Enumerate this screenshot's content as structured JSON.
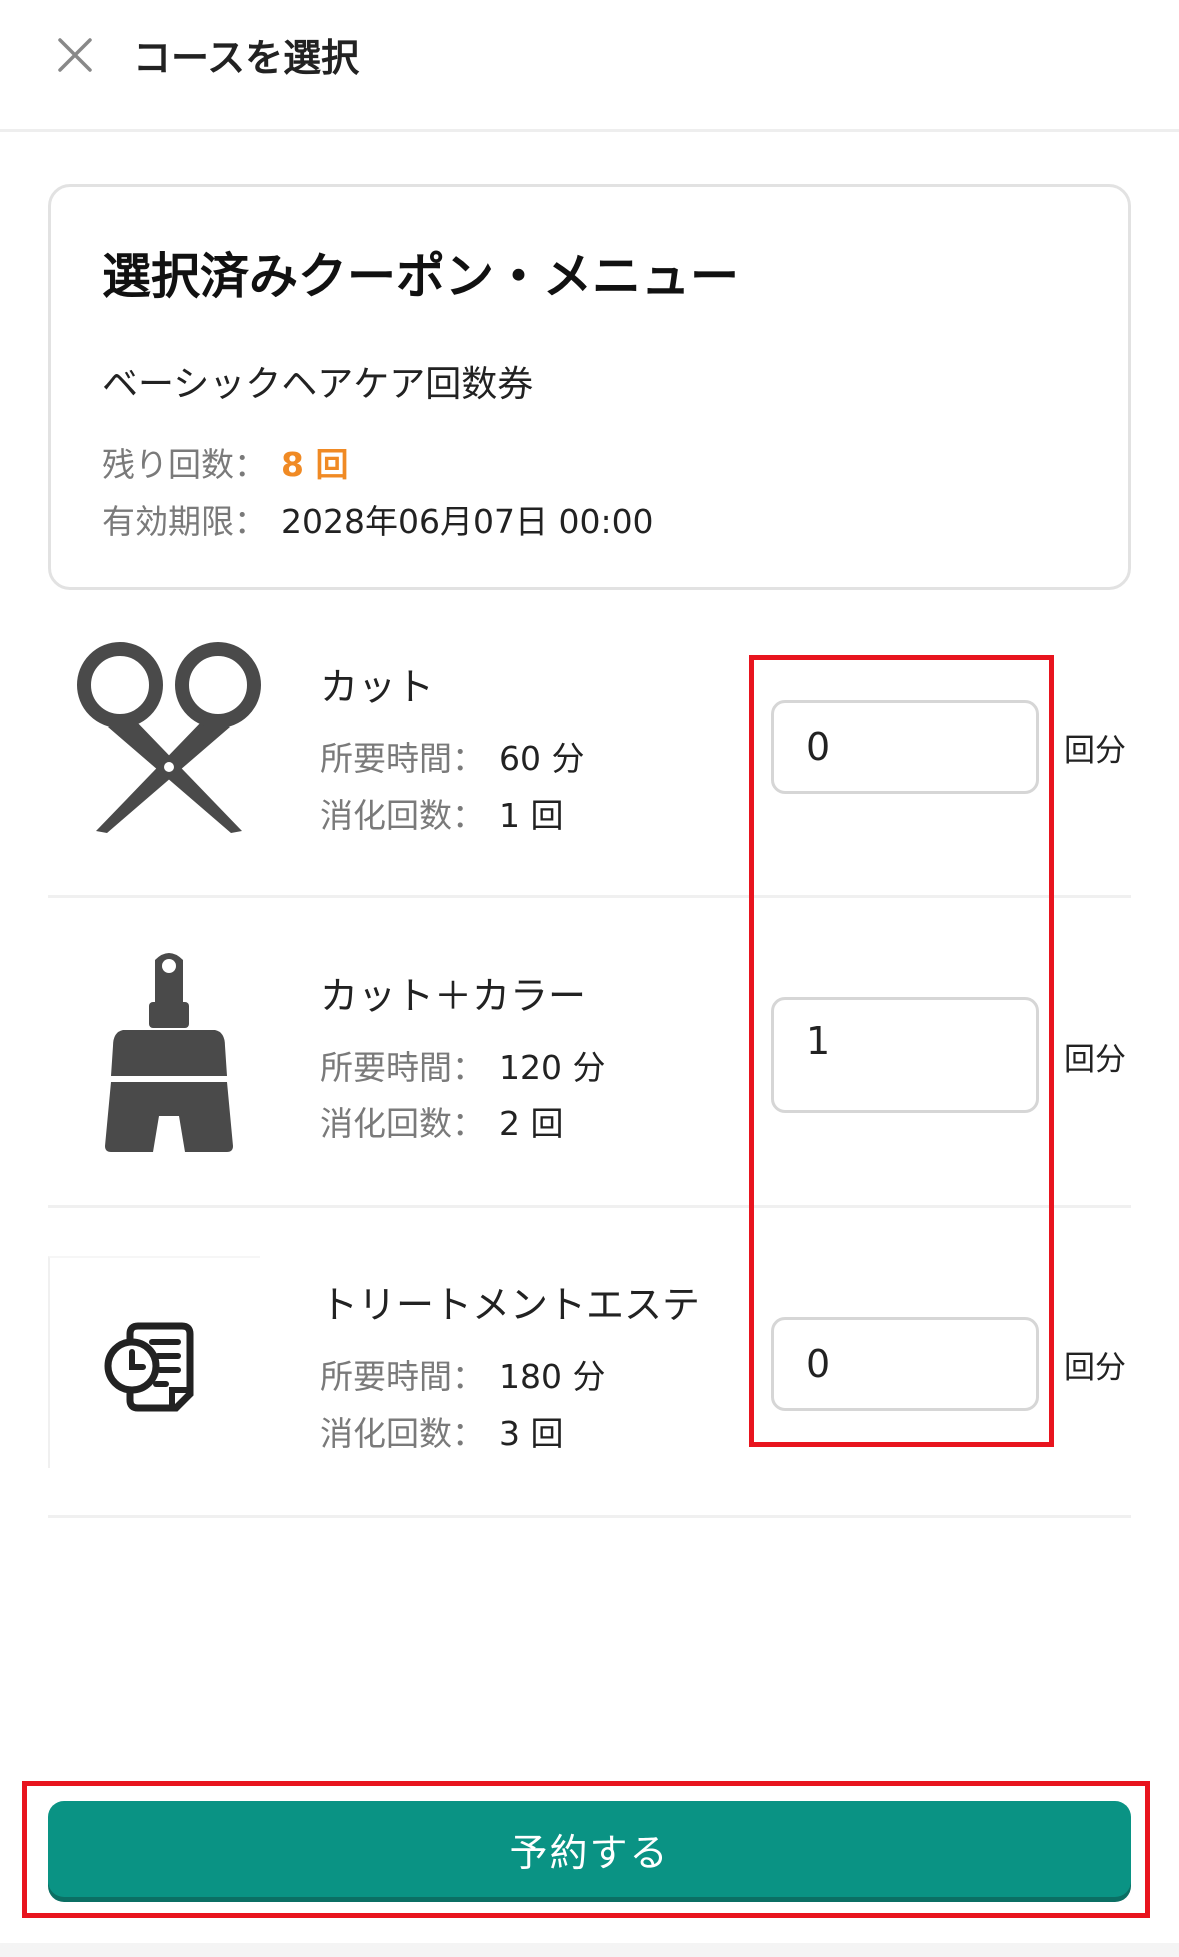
{
  "header": {
    "title": "コースを選択",
    "close_icon": "close-icon"
  },
  "selected": {
    "heading": "選択済みクーポン・メニュー",
    "name": "ベーシックヘアケア回数券",
    "remaining_label": "残り回数：",
    "remaining_value": "8 回",
    "expiry_label": "有効期限：",
    "expiry_value": "2028年06月07日 00:00"
  },
  "menu": {
    "items": [
      {
        "icon": "scissors-icon",
        "name": "カット",
        "duration_label": "所要時間：",
        "duration": "60 分",
        "consume_label": "消化回数：",
        "consume": "1 回",
        "quantity": "0",
        "unit": "回分"
      },
      {
        "icon": "brush-icon",
        "name": "カット＋カラー",
        "duration_label": "所要時間：",
        "duration": "120 分",
        "consume_label": "消化回数：",
        "consume": "2 回",
        "quantity": "1",
        "unit": "回分"
      },
      {
        "icon": "treatment-icon",
        "name": "トリートメントエステ",
        "duration_label": "所要時間：",
        "duration": "180 分",
        "consume_label": "消化回数：",
        "consume": "3 回",
        "quantity": "0",
        "unit": "回分"
      }
    ]
  },
  "footer": {
    "reserve_label": "予約する"
  },
  "colors": {
    "accent": "#0a9384",
    "remaining": "#f08a24",
    "highlight": "#e8141e"
  }
}
